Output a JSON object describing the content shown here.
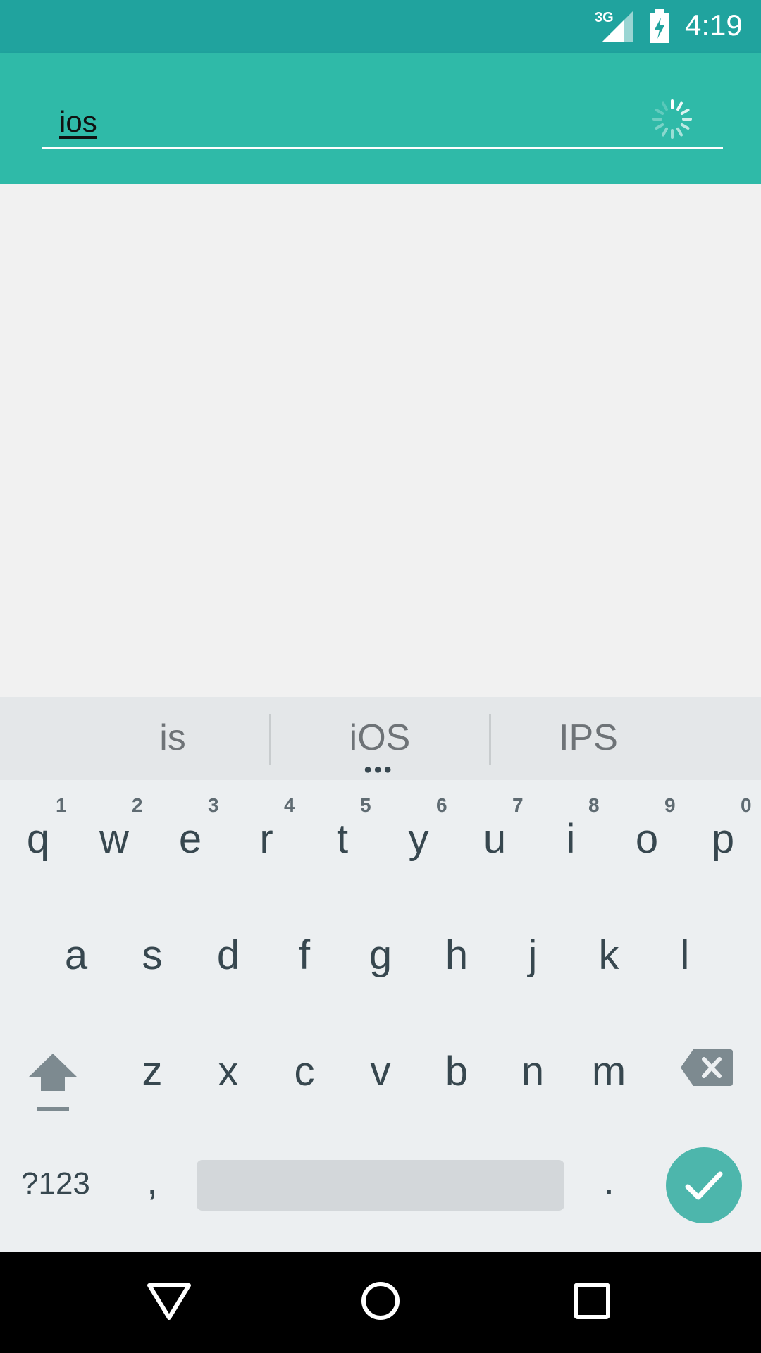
{
  "status_bar": {
    "network": "3G",
    "time": "4:19",
    "icons": [
      "signal-icon",
      "battery-charging-icon"
    ]
  },
  "search": {
    "value": "ios",
    "loading": true
  },
  "suggestions": [
    "is",
    "iOS",
    "IPS"
  ],
  "keyboard": {
    "row1": [
      "q",
      "w",
      "e",
      "r",
      "t",
      "y",
      "u",
      "i",
      "o",
      "p"
    ],
    "row1_hints": [
      "1",
      "2",
      "3",
      "4",
      "5",
      "6",
      "7",
      "8",
      "9",
      "0"
    ],
    "row2": [
      "a",
      "s",
      "d",
      "f",
      "g",
      "h",
      "j",
      "k",
      "l"
    ],
    "row3": [
      "z",
      "x",
      "c",
      "v",
      "b",
      "n",
      "m"
    ],
    "symbols_label": "?123",
    "comma": ",",
    "period": "."
  },
  "colors": {
    "status_bar": "#20a39e",
    "toolbar": "#2fbaa8",
    "accent": "#4db6ac"
  },
  "navigation": [
    "back-icon",
    "home-icon",
    "recents-icon"
  ]
}
